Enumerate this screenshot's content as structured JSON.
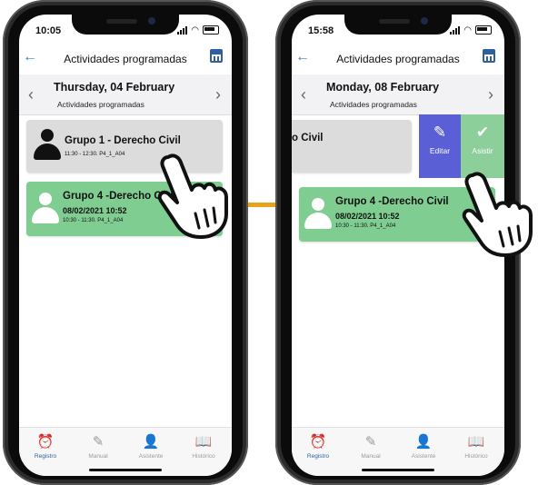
{
  "left_phone": {
    "time": "10:05",
    "header_title": "Actividades programadas",
    "date_title": "Thursday, 04 February",
    "date_subtitle": "Actividades programadas",
    "card1": {
      "title": "Grupo 1 - Derecho Civil",
      "meta": "11:30 - 12:30. P4_1_A04"
    },
    "card2": {
      "title": "Grupo 4 -Derecho Civil",
      "date": "08/02/2021 10:52",
      "meta": "10:30 - 11:30. P4_1_A04"
    }
  },
  "right_phone": {
    "time": "15:58",
    "header_title": "Actividades programadas",
    "date_title": "Monday, 08 February",
    "date_subtitle": "Actividades programadas",
    "card1": {
      "title_partial": "o Civil"
    },
    "swipe_actions": {
      "edit_label": "Editar",
      "attend_label": "Asistir"
    },
    "card2": {
      "title": "Grupo 4 -Derecho Civil",
      "date": "08/02/2021 10:52",
      "meta": "10:30 - 11:30. P4_1_A04"
    }
  },
  "tabs": [
    {
      "label": "Registro",
      "icon": "alarm-clock-icon"
    },
    {
      "label": "Manual",
      "icon": "edit-note-icon"
    },
    {
      "label": "Asistente",
      "icon": "user-check-icon"
    },
    {
      "label": "Histórico",
      "icon": "book-icon"
    }
  ],
  "colors": {
    "accent": "#2f5f9e",
    "card_gray": "#dcdcdc",
    "card_green": "#7fcd91",
    "edit_purple": "#5b5fd6",
    "attend_green": "#8ccf9a",
    "connector": "#e9a31a"
  }
}
